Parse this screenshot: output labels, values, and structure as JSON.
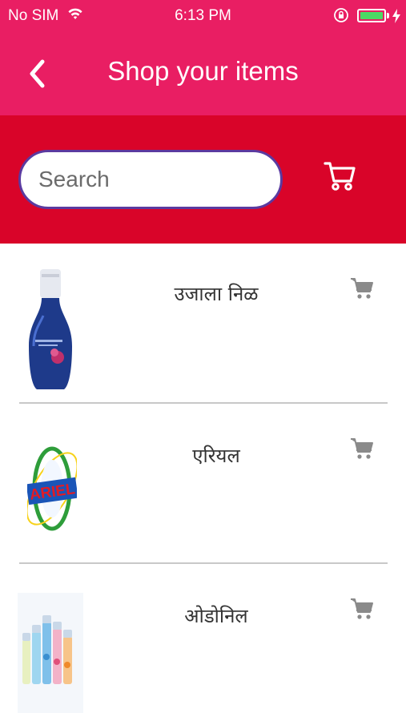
{
  "status_bar": {
    "carrier": "No SIM",
    "time": "6:13 PM"
  },
  "header": {
    "title": "Shop your items"
  },
  "search": {
    "placeholder": "Search",
    "value": ""
  },
  "products": [
    {
      "name": "उजाला निळ",
      "image": "ujala-bottle"
    },
    {
      "name": "एरियल",
      "image": "ariel-logo"
    },
    {
      "name": "ओडोनिल",
      "image": "odonil-sprays"
    }
  ],
  "colors": {
    "header": "#e91e63",
    "search_band": "#d90429",
    "search_border": "#5b3aa0",
    "cart_icon": "#8a8a8a"
  }
}
